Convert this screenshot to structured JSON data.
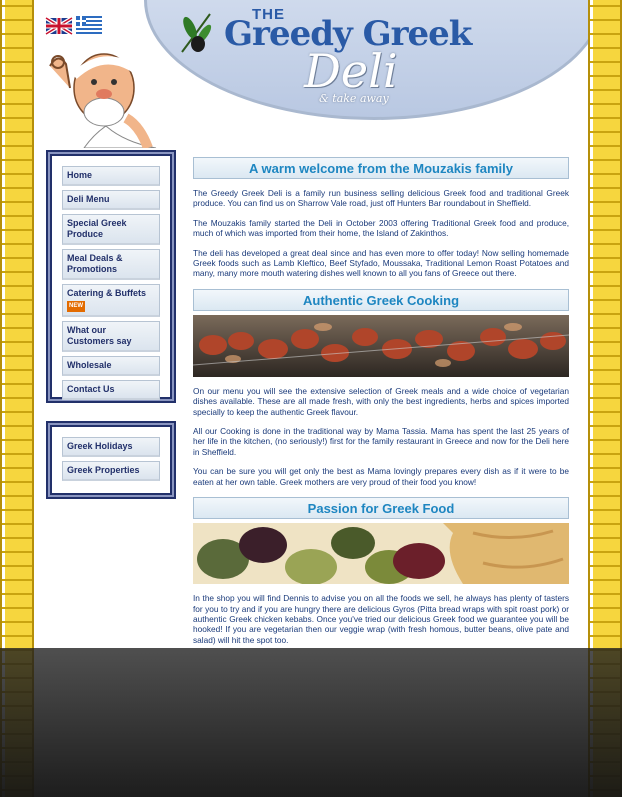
{
  "brand": {
    "the": "THE",
    "name": "Greedy Greek",
    "deli": "Deli",
    "sub": "& take away"
  },
  "nav": {
    "items": [
      {
        "label": "Home"
      },
      {
        "label": "Deli Menu"
      },
      {
        "label": "Special Greek Produce"
      },
      {
        "label": "Meal Deals & Promotions"
      },
      {
        "label": "Catering & Buffets",
        "badge": "NEW"
      },
      {
        "label": "What our Customers say"
      },
      {
        "label": "Wholesale"
      },
      {
        "label": "Contact Us"
      }
    ]
  },
  "nav2": {
    "items": [
      {
        "label": "Greek Holidays"
      },
      {
        "label": "Greek Properties"
      }
    ]
  },
  "sections": [
    {
      "title": "A warm welcome from the Mouzakis family",
      "paragraphs": [
        "The Greedy Greek Deli is a family run business selling delicious Greek food and traditional Greek produce. You can find us on Sharrow Vale road, just off Hunters Bar roundabout in Sheffield.",
        "The Mouzakis family started the Deli in October 2003 offering Traditional Greek food and produce, much of which was imported from their home, the Island of Zakinthos.",
        "The deli has developed a great deal since and has even more to offer today! Now selling homemade Greek foods such as Lamb Kleftico, Beef Styfado, Moussaka, Traditional Lemon Roast Potatoes and many, many more mouth watering dishes well known to all you fans of Greece out there."
      ]
    },
    {
      "title": "Authentic Greek Cooking",
      "paragraphs": [
        "On our menu you will see the extensive selection of Greek meals and a wide choice of vegetarian dishes available. These are all made fresh, with only the best ingredients, herbs and spices imported specially to keep the authentic Greek flavour.",
        "All our Cooking is done in the traditional way by Mama Tassia. Mama has spent the last 25 years of her life in the kitchen, (no seriously!) first for the family restaurant in Greece and now for the Deli here in Sheffield.",
        "You can be sure you will get only the best as Mama lovingly prepares every dish as if it were to be eaten at her own table. Greek mothers are very proud of their food you know!"
      ]
    },
    {
      "title": "Passion for Greek Food",
      "paragraphs": [
        "In the shop you will find Dennis to advise you on all the foods we sell, he always has plenty of tasters for you to try and if you are hungry there are delicious Gyros (Pitta bread wraps with spit roast pork) or authentic Greek chicken kebabs. Once you've tried our delicious Greek food we guarantee you will be hooked! If you are vegetarian then our veggie wrap (with fresh homous, butter beans, olive pate and salad) will hit the spot too."
      ]
    }
  ],
  "colors": {
    "accent": "#1e86c1",
    "text": "#1a3a7a",
    "nav_border": "#22306a",
    "greek_key": "#f6d63e"
  }
}
